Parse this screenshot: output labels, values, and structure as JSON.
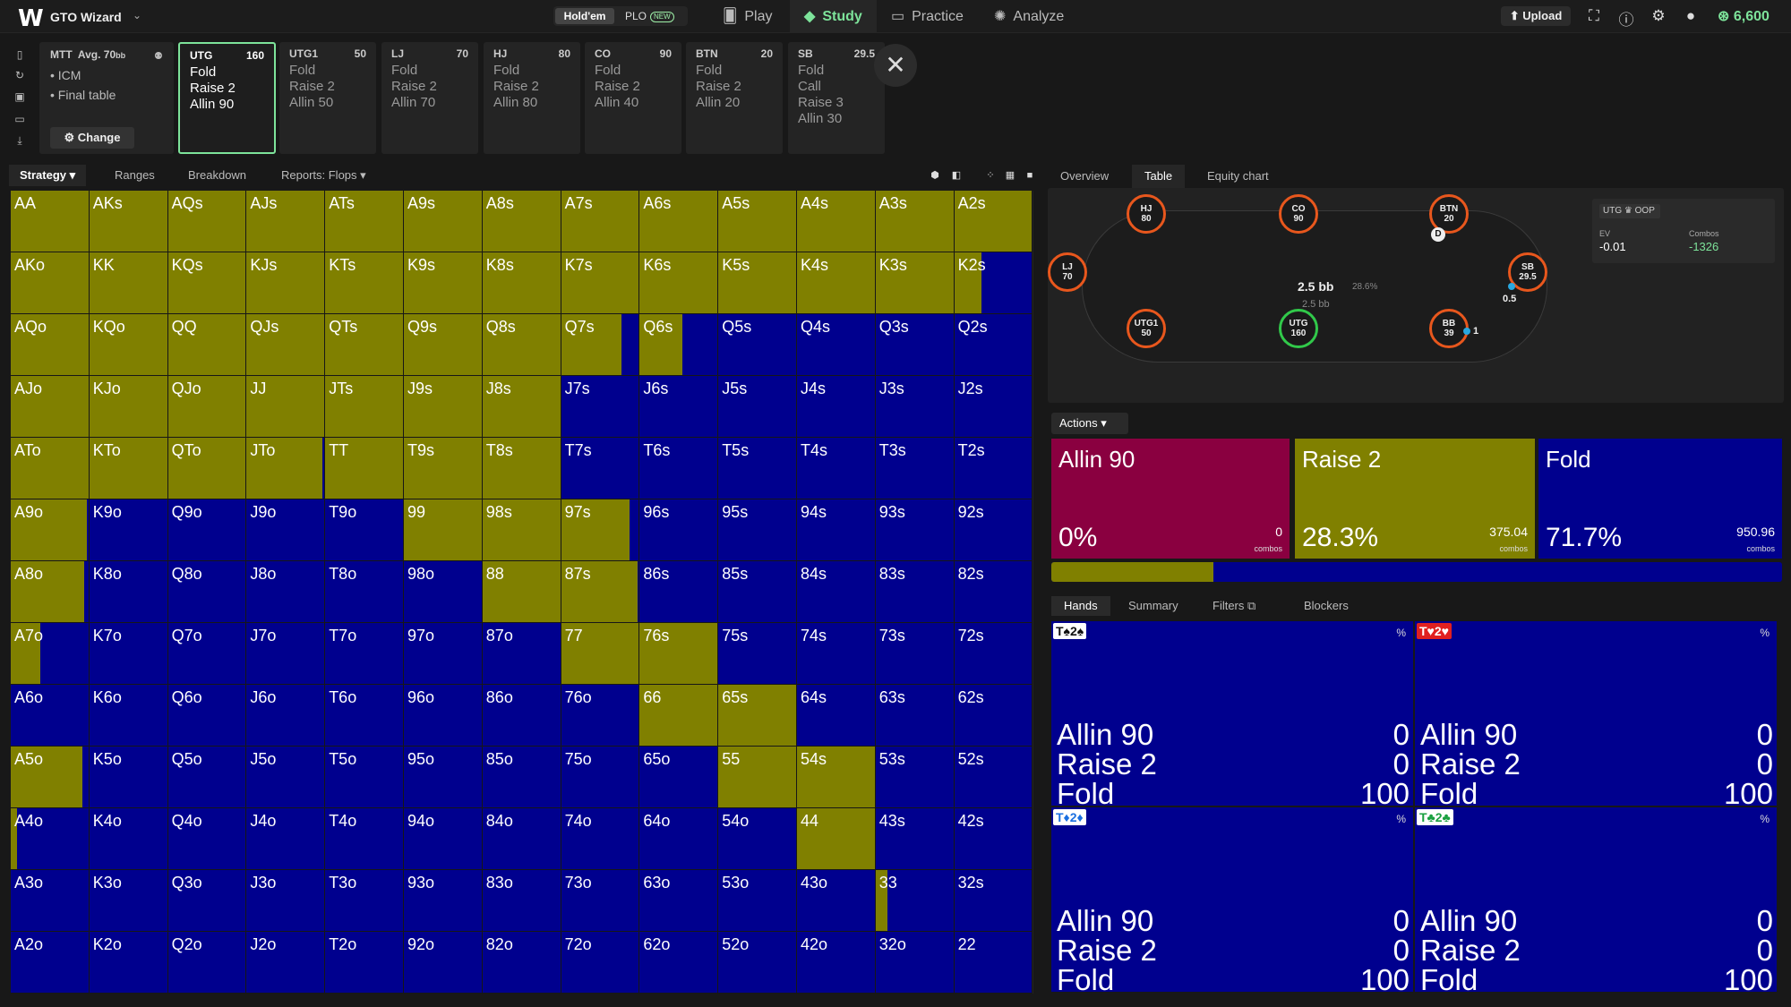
{
  "app": {
    "logo": "W",
    "name": "GTO Wizard"
  },
  "game_type": {
    "holdem": "Hold'em",
    "plo": "PLO",
    "new_badge": "NEW"
  },
  "nav": [
    {
      "label": "Play",
      "icon": "cards-icon"
    },
    {
      "label": "Study",
      "icon": "study-cap-icon"
    },
    {
      "label": "Practice",
      "icon": "gamepad-icon"
    },
    {
      "label": "Analyze",
      "icon": "bulb-icon"
    }
  ],
  "topbar": {
    "upload": "Upload",
    "coins": "6,600"
  },
  "scenario": {
    "format": "MTT",
    "depth": "Avg. 70",
    "depth_unit": "bb",
    "bullets": [
      "ICM",
      "Final table"
    ],
    "change": "Change"
  },
  "positions": [
    {
      "pos": "UTG",
      "stack": "160",
      "lines": [
        "Fold",
        "Raise 2",
        "Allin 90"
      ]
    },
    {
      "pos": "UTG1",
      "stack": "50",
      "lines": [
        "Fold",
        "Raise 2",
        "Allin 50"
      ]
    },
    {
      "pos": "LJ",
      "stack": "70",
      "lines": [
        "Fold",
        "Raise 2",
        "Allin 70"
      ]
    },
    {
      "pos": "HJ",
      "stack": "80",
      "lines": [
        "Fold",
        "Raise 2",
        "Allin 80"
      ]
    },
    {
      "pos": "CO",
      "stack": "90",
      "lines": [
        "Fold",
        "Raise 2",
        "Allin 40"
      ]
    },
    {
      "pos": "BTN",
      "stack": "20",
      "lines": [
        "Fold",
        "Raise 2",
        "Allin 20"
      ]
    },
    {
      "pos": "SB",
      "stack": "29.5",
      "lines": [
        "Fold",
        "Call",
        "Raise 3",
        "Allin 30"
      ]
    }
  ],
  "strategy_tabs": [
    "Strategy",
    "Ranges",
    "Breakdown",
    "Reports: Flops"
  ],
  "right_tabs": [
    "Overview",
    "Table",
    "Equity chart"
  ],
  "grid": {
    "ranks": [
      "A",
      "K",
      "Q",
      "J",
      "T",
      "9",
      "8",
      "7",
      "6",
      "5",
      "4",
      "3",
      "2"
    ],
    "raise_fraction": [
      [
        1,
        1,
        1,
        1,
        1,
        1,
        1,
        1,
        1,
        1,
        1,
        1,
        1
      ],
      [
        1,
        1,
        1,
        1,
        1,
        1,
        1,
        1,
        1,
        1,
        1,
        1,
        0.35
      ],
      [
        1,
        1,
        1,
        1,
        1,
        1,
        1,
        0.78,
        0.55,
        0,
        0,
        0,
        0
      ],
      [
        1,
        1,
        1,
        1,
        1,
        1,
        1,
        0,
        0,
        0,
        0,
        0,
        0
      ],
      [
        1,
        1,
        1,
        0.98,
        1,
        1,
        1,
        0,
        0,
        0,
        0,
        0,
        0
      ],
      [
        0.98,
        0,
        0,
        0,
        0,
        1,
        1,
        0.88,
        0,
        0,
        0,
        0,
        0
      ],
      [
        0.95,
        0,
        0,
        0,
        0,
        0,
        1,
        0.98,
        0,
        0,
        0,
        0,
        0
      ],
      [
        0.38,
        0,
        0,
        0,
        0,
        0,
        0,
        1,
        1,
        0,
        0,
        0,
        0
      ],
      [
        0,
        0,
        0,
        0,
        0,
        0,
        0,
        0,
        1,
        1,
        0,
        0,
        0
      ],
      [
        0.92,
        0,
        0,
        0,
        0,
        0,
        0,
        0,
        0,
        1,
        1,
        0,
        0
      ],
      [
        0.08,
        0,
        0,
        0,
        0,
        0,
        0,
        0,
        0,
        0,
        1,
        0,
        0
      ],
      [
        0,
        0,
        0,
        0,
        0,
        0,
        0,
        0,
        0,
        0,
        0,
        0.15,
        0
      ],
      [
        0,
        0,
        0,
        0,
        0,
        0,
        0,
        0,
        0,
        0,
        0,
        0,
        0
      ]
    ]
  },
  "table": {
    "seats": [
      {
        "pos": "HJ",
        "stack": "80"
      },
      {
        "pos": "CO",
        "stack": "90"
      },
      {
        "pos": "BTN",
        "stack": "20"
      },
      {
        "pos": "LJ",
        "stack": "70"
      },
      {
        "pos": "SB",
        "stack": "29.5"
      },
      {
        "pos": "UTG1",
        "stack": "50"
      },
      {
        "pos": "UTG",
        "stack": "160"
      },
      {
        "pos": "BB",
        "stack": "39"
      }
    ],
    "dealer": "D",
    "pot": "2.5 bb",
    "pot_pct": "28.6%",
    "pot_sub": "2.5 bb",
    "sb_chip": "0.5",
    "bb_chip": "1",
    "evbox": {
      "header": "UTG",
      "oop": "OOP",
      "ev_label": "EV",
      "ev_value": "-0.01",
      "combos_label": "Combos",
      "combos_value": "-1326"
    }
  },
  "actions": {
    "dropdown": "Actions",
    "items": [
      {
        "name": "Allin 90",
        "pct": "0%",
        "combos": "0",
        "color": "#8a0040"
      },
      {
        "name": "Raise 2",
        "pct": "28.3%",
        "combos": "375.04",
        "color": "#808000"
      },
      {
        "name": "Fold",
        "pct": "71.7%",
        "combos": "950.96",
        "color": "#00008e"
      }
    ],
    "combos_label": "combos",
    "raise_fill": 0.222
  },
  "hands_tabs": [
    "Hands",
    "Summary",
    "Filters",
    "Blockers"
  ],
  "hands": [
    {
      "c1": "T",
      "s1": "♠",
      "c2": "2",
      "s2": "♠",
      "color": "#111",
      "rows": [
        [
          "Allin 90",
          "0"
        ],
        [
          "Raise 2",
          "0"
        ],
        [
          "Fold",
          "100"
        ]
      ]
    },
    {
      "c1": "T",
      "s1": "♥",
      "c2": "2",
      "s2": "♥",
      "color": "#e02020",
      "bg": "#e02020",
      "rows": [
        [
          "Allin 90",
          "0"
        ],
        [
          "Raise 2",
          "0"
        ],
        [
          "Fold",
          "100"
        ]
      ]
    },
    {
      "c1": "T",
      "s1": "♦",
      "c2": "2",
      "s2": "♦",
      "color": "#1a6fe0",
      "rows": [
        [
          "Allin 90",
          "0"
        ],
        [
          "Raise 2",
          "0"
        ],
        [
          "Fold",
          "100"
        ]
      ]
    },
    {
      "c1": "T",
      "s1": "♣",
      "c2": "2",
      "s2": "♣",
      "color": "#1aa040",
      "rows": [
        [
          "Allin 90",
          "0"
        ],
        [
          "Raise 2",
          "0"
        ],
        [
          "Fold",
          "100"
        ]
      ]
    }
  ],
  "pct_label": "%",
  "colors": {
    "raise": "#808000",
    "fold": "#00008e",
    "allin": "#8a0040",
    "accent": "#7de39a"
  }
}
